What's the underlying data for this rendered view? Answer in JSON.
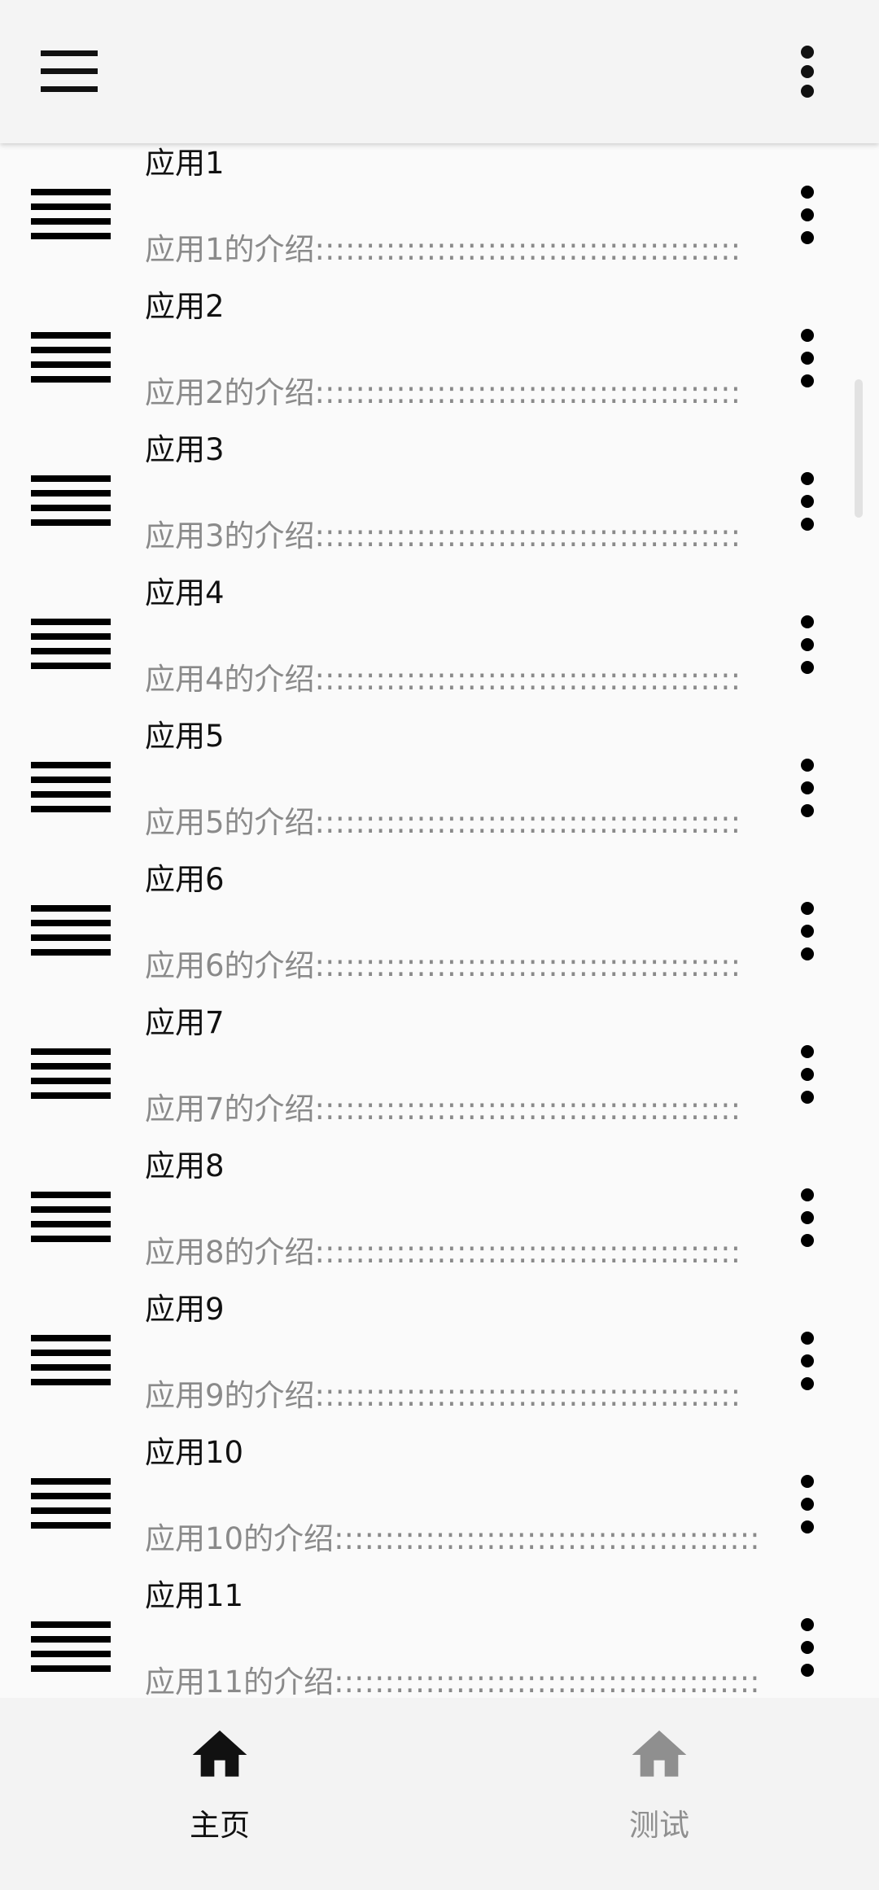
{
  "app_bar": {
    "menu_icon": "hamburger-menu-icon",
    "more_icon": "more-vert-icon"
  },
  "list": {
    "items": [
      {
        "title": "应用1",
        "description": "应用1的介绍::::::::::::::::::::::::::::::::::::::::::"
      },
      {
        "title": "应用2",
        "description": "应用2的介绍::::::::::::::::::::::::::::::::::::::::::"
      },
      {
        "title": "应用3",
        "description": "应用3的介绍::::::::::::::::::::::::::::::::::::::::::"
      },
      {
        "title": "应用4",
        "description": "应用4的介绍::::::::::::::::::::::::::::::::::::::::::"
      },
      {
        "title": "应用5",
        "description": "应用5的介绍::::::::::::::::::::::::::::::::::::::::::"
      },
      {
        "title": "应用6",
        "description": "应用6的介绍::::::::::::::::::::::::::::::::::::::::::"
      },
      {
        "title": "应用7",
        "description": "应用7的介绍::::::::::::::::::::::::::::::::::::::::::"
      },
      {
        "title": "应用8",
        "description": "应用8的介绍::::::::::::::::::::::::::::::::::::::::::"
      },
      {
        "title": "应用9",
        "description": "应用9的介绍::::::::::::::::::::::::::::::::::::::::::"
      },
      {
        "title": "应用10",
        "description": "应用10的介绍::::::::::::::::::::::::::::::::::::::::::"
      },
      {
        "title": "应用11",
        "description": "应用11的介绍::::::::::::::::::::::::::::::::::::::::::"
      }
    ]
  },
  "bottom_nav": {
    "items": [
      {
        "label": "主页",
        "icon": "home-icon",
        "selected": true
      },
      {
        "label": "测试",
        "icon": "home-icon",
        "selected": false
      }
    ]
  },
  "colors": {
    "app_bar_bg": "#f4f4f4",
    "page_bg": "#fafafa",
    "nav_bg": "#f3f3f3",
    "text_primary": "#111111",
    "text_secondary": "#8a8a8a",
    "nav_active": "#111111",
    "nav_inactive": "#8f8f8f"
  }
}
